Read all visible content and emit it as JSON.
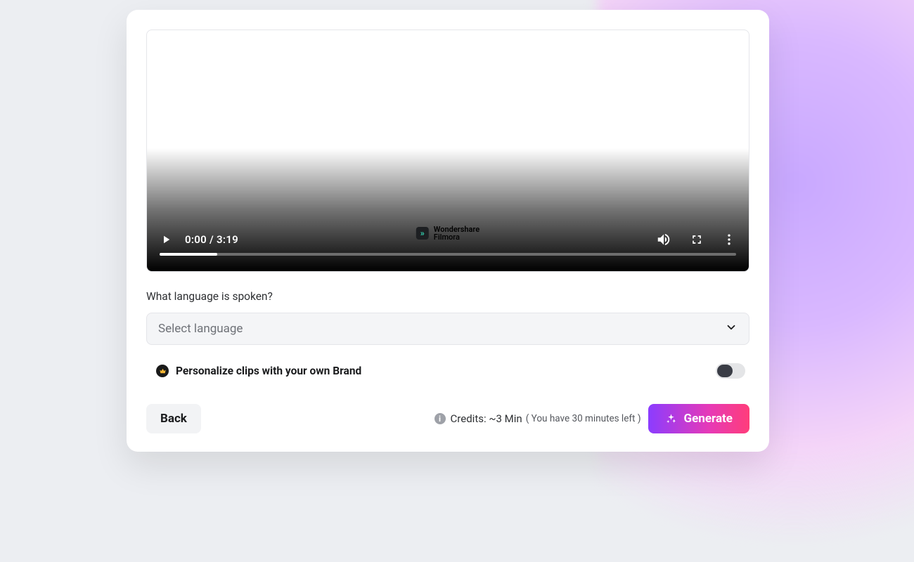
{
  "video": {
    "current_time": "0:00",
    "duration": "3:19",
    "time_display": "0:00 / 3:19",
    "progress_percent": 10,
    "watermark_line1": "Wondershare",
    "watermark_line2": "Filmora"
  },
  "language": {
    "question": "What language is spoken?",
    "placeholder": "Select language"
  },
  "personalize": {
    "label": "Personalize clips with your own Brand",
    "enabled": false
  },
  "footer": {
    "back_label": "Back",
    "credits_label": "Credits: ~3 Min",
    "credits_note": "( You have 30 minutes left )",
    "generate_label": "Generate"
  }
}
